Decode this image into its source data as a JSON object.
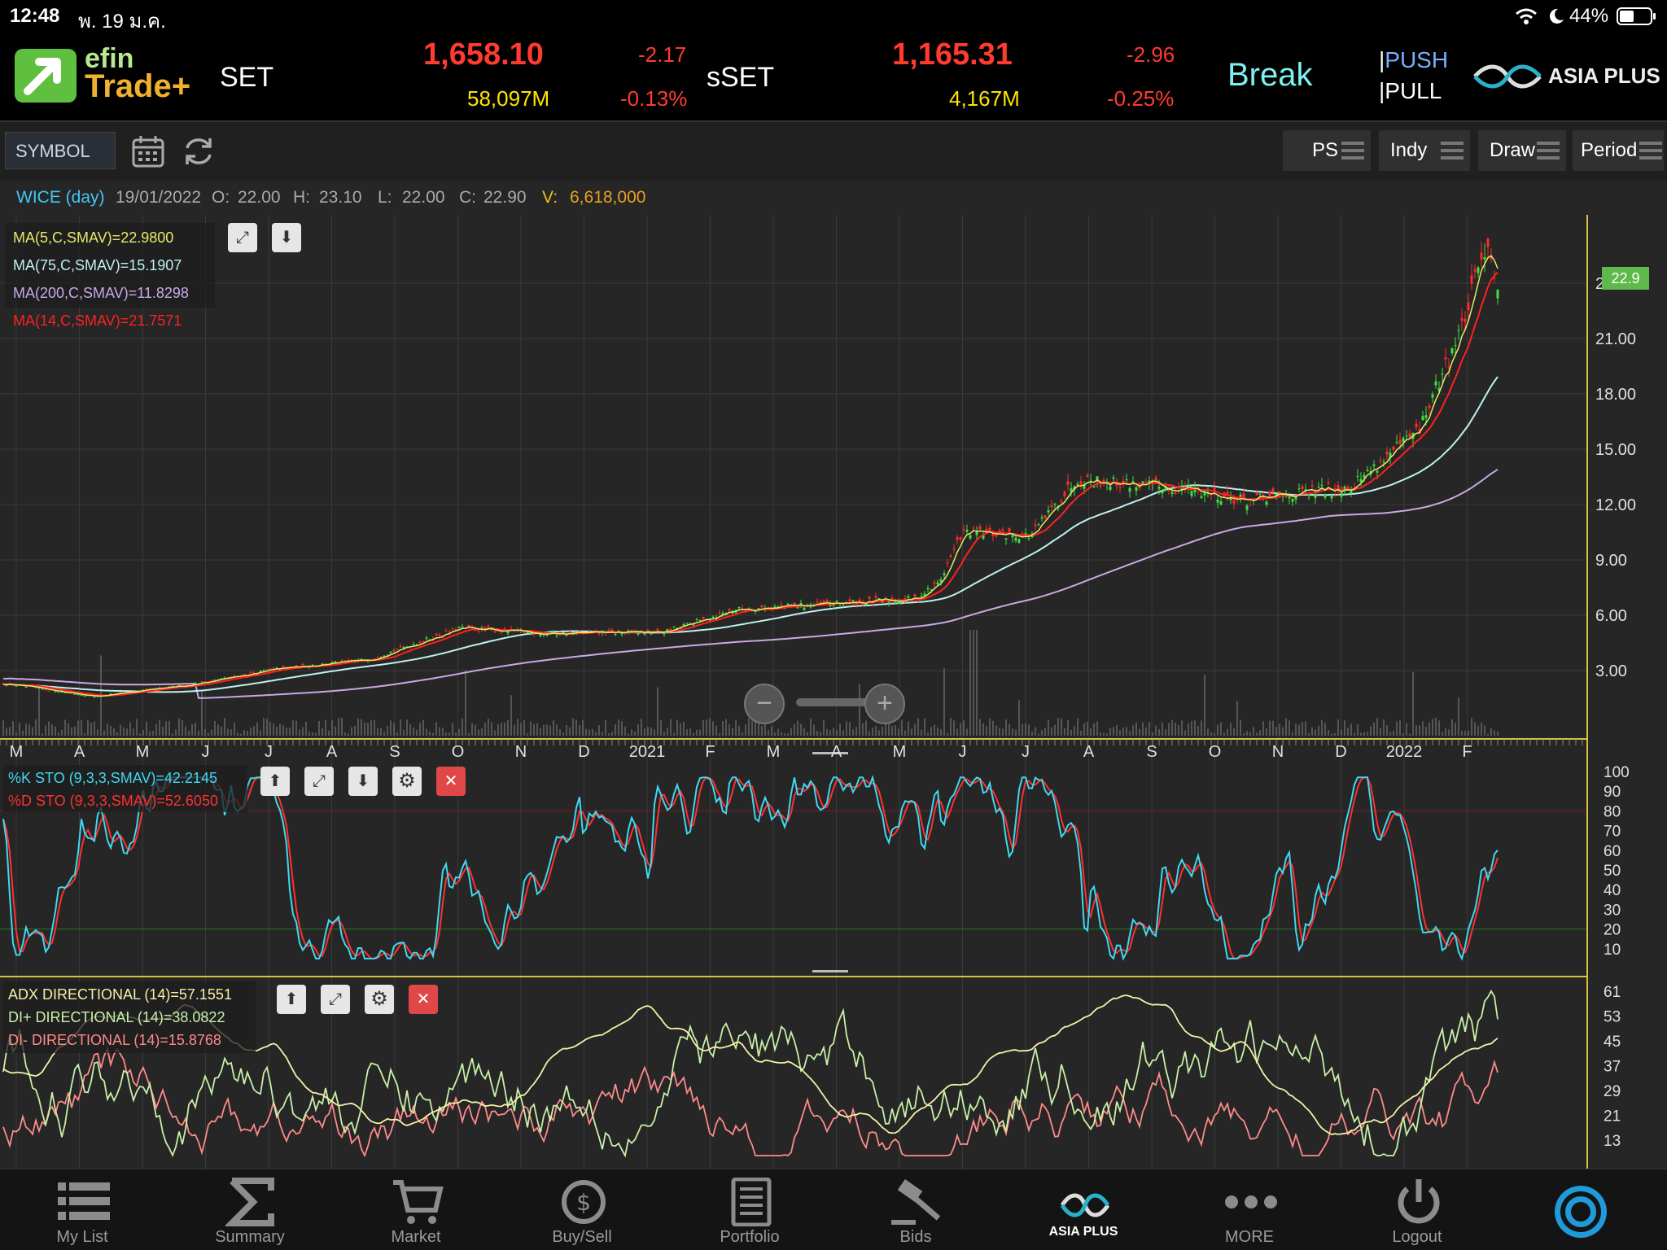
{
  "status_bar": {
    "time": "12:48",
    "date": "พ. 19 ม.ค.",
    "battery": "44%"
  },
  "header": {
    "logo_top": "efin",
    "logo_bottom": "Trade+",
    "set": {
      "name": "SET",
      "value": "1,658.10",
      "change": "-2.17",
      "volume": "58,097M",
      "change_pct": "-0.13%"
    },
    "sset": {
      "name": "sSET",
      "value": "1,165.31",
      "change": "-2.96",
      "volume": "4,167M",
      "change_pct": "-0.25%"
    },
    "market_status": "Break",
    "push": "PUSH",
    "pull": "PULL",
    "broker": "ASIA PLUS"
  },
  "toolbar": {
    "symbol_placeholder": "SYMBOL",
    "buttons": [
      {
        "label": "PS"
      },
      {
        "label": "Indy"
      },
      {
        "label": "Draw"
      },
      {
        "label": "Period"
      }
    ]
  },
  "info": {
    "symbol": "WICE (day)",
    "date": "19/01/2022",
    "o_label": "O:",
    "o": "22.00",
    "h_label": "H:",
    "h": "23.10",
    "l_label": "L:",
    "l": "22.00",
    "c_label": "C:",
    "c": "22.90",
    "v_label": "V:",
    "v": "6,618,000"
  },
  "price_panel": {
    "legend": [
      {
        "text": "MA(5,C,SMAV)=22.9800",
        "color": "#e8e86a"
      },
      {
        "text": "MA(75,C,SMAV)=15.1907",
        "color": "#bff0f0"
      },
      {
        "text": "MA(200,C,SMAV)=11.8298",
        "color": "#c9a8e6"
      },
      {
        "text": "MA(14,C,SMAV)=21.7571",
        "color": "#ff2020"
      }
    ],
    "last_price_tag": "22.9",
    "y_ticks": [
      "24.00",
      "21.00",
      "18.00",
      "15.00",
      "12.00",
      "9.00",
      "6.00",
      "3.00"
    ],
    "x_labels": [
      "M",
      "A",
      "M",
      "J",
      "J",
      "A",
      "S",
      "O",
      "N",
      "D",
      "2021",
      "F",
      "M",
      "A",
      "M",
      "J",
      "J",
      "A",
      "S",
      "O",
      "N",
      "D",
      "2022",
      "F"
    ]
  },
  "sto_panel": {
    "legend": [
      {
        "text": "%K STO (9,3,3,SMAV)=42.2145",
        "color": "#40d8f0"
      },
      {
        "text": "%D STO (9,3,3,SMAV)=52.6050",
        "color": "#ff3030"
      }
    ],
    "y_ticks": [
      "100",
      "90",
      "80",
      "70",
      "60",
      "50",
      "40",
      "30",
      "20",
      "10"
    ]
  },
  "adx_panel": {
    "legend": [
      {
        "text": "ADX DIRECTIONAL (14)=57.1551",
        "color": "#f4f0a8"
      },
      {
        "text": "DI+ DIRECTIONAL (14)=38.0822",
        "color": "#c8f0a8"
      },
      {
        "text": "DI- DIRECTIONAL (14)=15.8768",
        "color": "#ff8a8a"
      }
    ],
    "y_ticks": [
      "61",
      "53",
      "45",
      "37",
      "29",
      "21",
      "13"
    ]
  },
  "bottom_nav": [
    {
      "label": "My List",
      "icon": "list-icon"
    },
    {
      "label": "Summary",
      "icon": "sigma-icon"
    },
    {
      "label": "Market",
      "icon": "cart-icon"
    },
    {
      "label": "Buy/Sell",
      "icon": "money-icon"
    },
    {
      "label": "Portfolio",
      "icon": "document-icon"
    },
    {
      "label": "Bids",
      "icon": "gavel-icon"
    },
    {
      "label": "ASIA PLUS",
      "icon": "asia-plus-icon"
    },
    {
      "label": "MORE",
      "icon": "more-icon"
    },
    {
      "label": "Logout",
      "icon": "power-icon"
    }
  ]
}
